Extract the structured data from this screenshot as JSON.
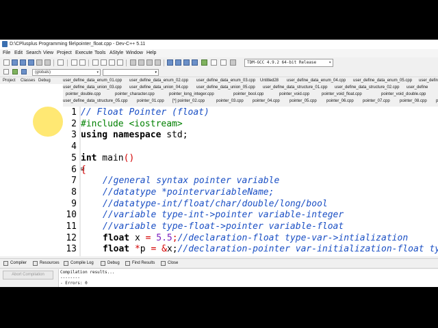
{
  "window": {
    "title": "D:\\CPlusplus Programming file\\pointer_float.cpp - Dev-C++ 5.11"
  },
  "menu": [
    "File",
    "Edit",
    "Search",
    "View",
    "Project",
    "Execute",
    "Tools",
    "AStyle",
    "Window",
    "Help"
  ],
  "toolbar": {
    "compiler": "TDM-GCC 4.9.2 64-bit Release"
  },
  "scope": {
    "value": "(globals)"
  },
  "left_tabs": [
    "Project",
    "Classes",
    "Debug"
  ],
  "file_tabs": {
    "row1": [
      "user_define_data_enum_01.cpp",
      "user_define_data_enum_02.cpp",
      "user_define_data_enum_03.cpp",
      "Untitled28",
      "user_define_data_enum_04.cpp",
      "user_define_data_enum_05.cpp",
      "user_defin"
    ],
    "row2": [
      "user_define_data_union_03.cpp",
      "user_define_data_union_04.cpp",
      "user_define_data_union_05.cpp",
      "user_define_data_structure_01.cpp",
      "user_define_data_structure_02.cpp",
      "user_define"
    ],
    "row3": [
      "pointer_double.cpp",
      "pointer_character.cpp",
      "pointer_long_integer.cpp",
      "pointer_bool.cpp",
      "pointer_void.cpp",
      "pointer_void_float.cpp",
      "pointer_void_double.cpp"
    ],
    "row4": [
      "user_define_data_structure_05.cpp",
      "pointer_01.cpp",
      "[*] pointer_02.cpp",
      "pointer_03.cpp",
      "pointer_04.cpp",
      "pointer_05.cpp",
      "pointer_06.cpp",
      "pointer_07.cpp",
      "pointer_08.cpp",
      "p"
    ]
  },
  "editor": {
    "line_numbers": [
      "1",
      "2",
      "3",
      "4",
      "5",
      "6",
      "7",
      "8",
      "9",
      "10",
      "11",
      "12",
      "13"
    ],
    "lines": {
      "l1": "// Float Pointer (float)",
      "l2": "#include <iostream>",
      "l3_kw": "using namespace",
      "l3_rest": " std;",
      "l5_kw": "int",
      "l5_rest": " main",
      "l5_paren": "()",
      "l6": "{",
      "l7": "//general syntax pointer variable",
      "l8": "//datatype *pointervariableName;",
      "l9": "//datatype-int/float/char/double/long/bool",
      "l10": "//variable type-int->pointer variable-integer",
      "l11": "//variable type-float->pointer variable-float",
      "l12_kw": "float",
      "l12_var": " x ",
      "l12_eq": "=",
      "l12_num": " 5.5",
      "l12_semi": ";",
      "l12_cmt": "//declaration-float type-var->intialization",
      "l13_kw": "float",
      "l13_ptr": " *",
      "l13_var": "p ",
      "l13_eq": "=",
      "l13_amp": " &",
      "l13_x": "x;",
      "l13_cmt": "//declaration-pointer var-initialization-float ty"
    }
  },
  "bottom_tabs": [
    "Compiler",
    "Resources",
    "Compile Log",
    "Debug",
    "Find Results",
    "Close"
  ],
  "compile": {
    "abort_label": "Abort Compilation",
    "log": [
      "Compilation results...",
      "--------",
      "- Errors: 0"
    ]
  }
}
